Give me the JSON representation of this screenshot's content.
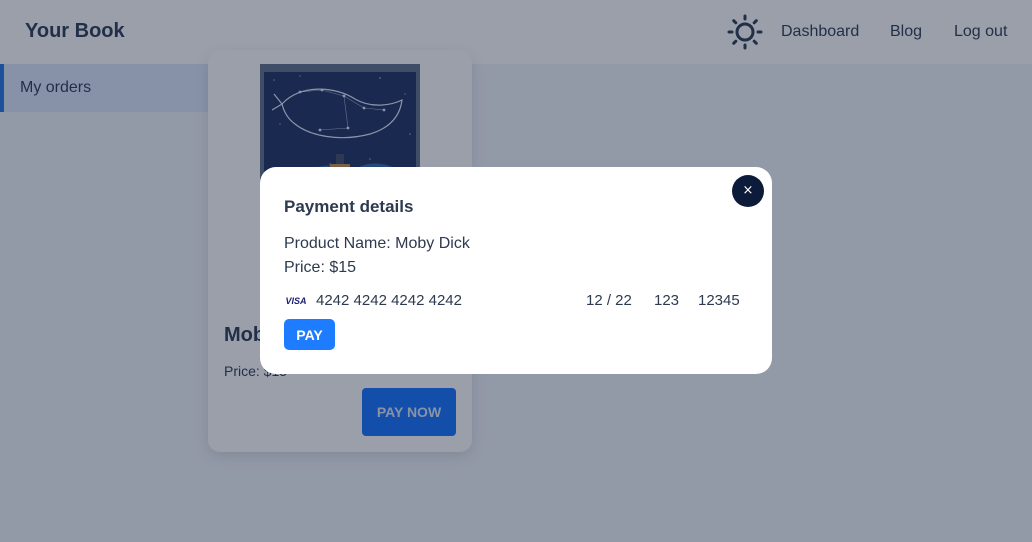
{
  "header": {
    "brand": "Your Book",
    "theme_icon": "sun-icon",
    "nav": {
      "dashboard": "Dashboard",
      "blog": "Blog",
      "logout": "Log out"
    }
  },
  "sidebar": {
    "items": [
      {
        "label": "My orders",
        "active": true
      }
    ]
  },
  "product_card": {
    "title": "Moby Dick",
    "price": "Price: $15",
    "button": "PAY NOW"
  },
  "modal": {
    "title": "Payment details",
    "product_name": "Product Name: Moby Dick",
    "price": "Price: $15",
    "card_brand_icon": "visa-icon",
    "card_brand_text": "VISA",
    "card_number": "4242 4242 4242 4242",
    "expiry": "12 / 22",
    "cvc": "123",
    "zip": "12345",
    "pay_button": "PAY",
    "close_icon": "close-icon",
    "close_glyph": "×"
  },
  "colors": {
    "accent": "#0a6cff",
    "overlay": "#1e2b42",
    "close_bg": "#0d1b3a",
    "text": "#25344d"
  }
}
